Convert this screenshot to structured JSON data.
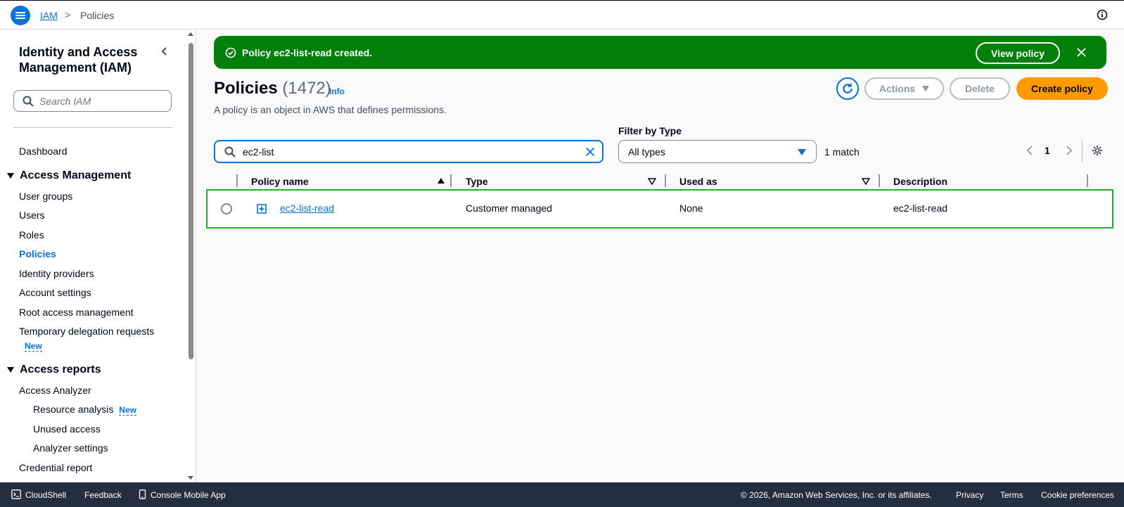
{
  "header": {
    "breadcrumb_root": "IAM",
    "breadcrumb_sep": ">",
    "breadcrumb_current": "Policies"
  },
  "sidebar": {
    "title": "Identity and Access Management (IAM)",
    "search_placeholder": "Search IAM",
    "dashboard": "Dashboard",
    "section_access_management": "Access Management",
    "items": [
      "User groups",
      "Users",
      "Roles",
      "Policies",
      "Identity providers",
      "Account settings",
      "Root access management",
      "Temporary delegation requests"
    ],
    "new_badge": "New",
    "section_access_reports": "Access reports",
    "access_analyzer": "Access Analyzer",
    "resource_analysis": "Resource analysis",
    "resource_analysis_badge": "New",
    "unused_access": "Unused access",
    "analyzer_settings": "Analyzer settings",
    "credential_report": "Credential report"
  },
  "flash": {
    "message": "Policy ec2-list-read created.",
    "view_button": "View policy"
  },
  "page": {
    "title": "Policies",
    "count": "(1472)",
    "info": "Info",
    "description": "A policy is an object in AWS that defines permissions."
  },
  "toolbar": {
    "actions_label": "Actions",
    "delete_label": "Delete",
    "create_label": "Create policy"
  },
  "filter": {
    "search_value": "ec2-list",
    "type_label": "Filter by Type",
    "type_value": "All types",
    "match_text": "1 match"
  },
  "pagination": {
    "current_page": "1"
  },
  "table": {
    "columns": [
      "Policy name",
      "Type",
      "Used as",
      "Description"
    ],
    "rows": [
      {
        "name": "ec2-list-read",
        "type": "Customer managed",
        "used_as": "None",
        "description": "ec2-list-read"
      }
    ]
  },
  "footer": {
    "cloudshell": "CloudShell",
    "feedback": "Feedback",
    "mobile_app": "Console Mobile App",
    "copyright": "© 2026, Amazon Web Services, Inc. or its affiliates.",
    "privacy": "Privacy",
    "terms": "Terms",
    "cookie": "Cookie preferences"
  },
  "colors": {
    "accent": "#0972d3",
    "success": "#037f0c",
    "primary_button": "#ff9900",
    "footer_bg": "#232f3e"
  }
}
